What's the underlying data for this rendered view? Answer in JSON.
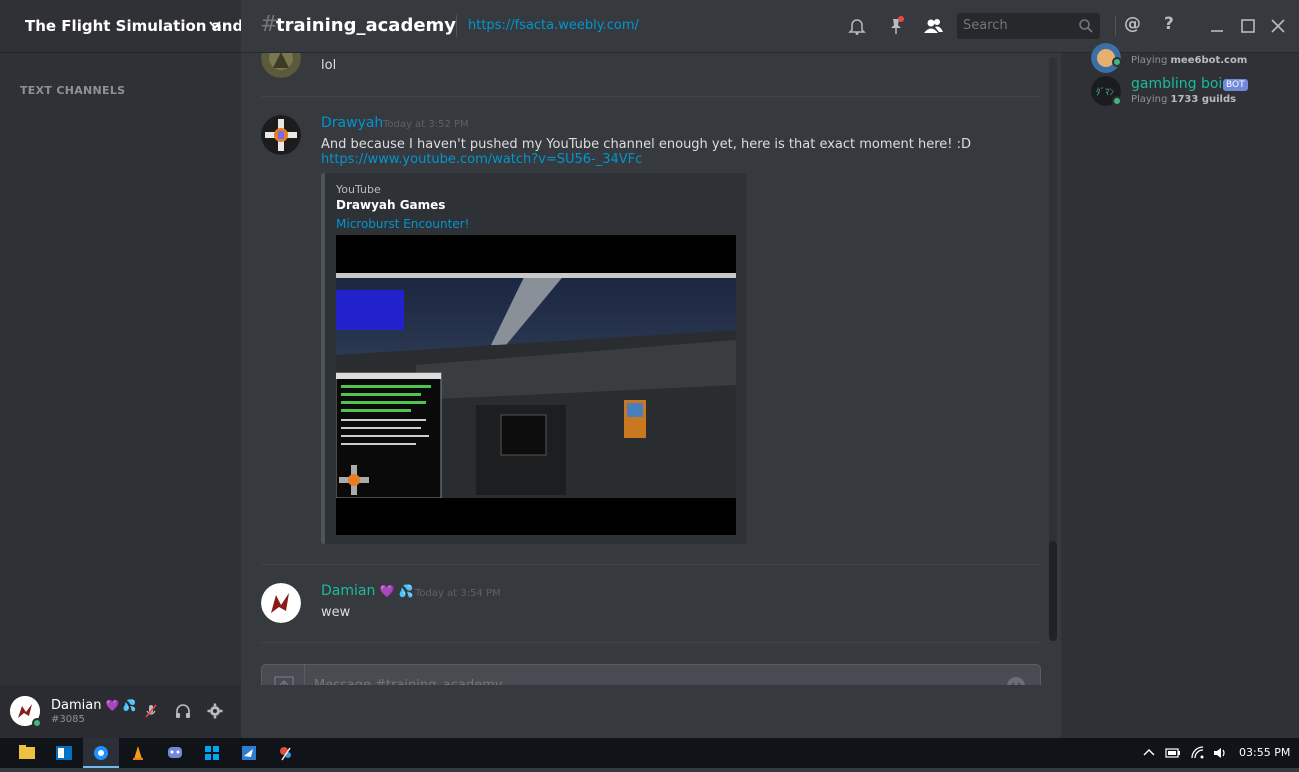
{
  "guild": {
    "name": "The Flight Simulation and...",
    "chevron_icon": "chevron-down-icon"
  },
  "sidebar": {
    "category_label": "TEXT CHANNELS"
  },
  "user_panel": {
    "name": "Damian",
    "badges": "💜 💦",
    "tag": "#3085"
  },
  "topbar": {
    "channel_hash": "#",
    "channel_name": "training_academy",
    "topic": "https://fsacta.weebly.com/",
    "search_placeholder": "Search",
    "icons": [
      "bell-icon",
      "pin-icon",
      "members-icon",
      "mention-icon",
      "help-icon",
      "minimize-icon",
      "maximize-icon",
      "close-icon"
    ],
    "help_glyph": "?",
    "mention_glyph": "@"
  },
  "messages": [
    {
      "author": "",
      "timestamp": "",
      "text": "lol"
    },
    {
      "author": "Drawyah",
      "author_color": "#0096cf",
      "timestamp": "Today at 3:52 PM",
      "text": "And because I haven't pushed my YouTube channel enough yet, here is that exact moment here! :D",
      "link": "https://www.youtube.com/watch?v=SU56-_34VFc",
      "embed": {
        "provider": "YouTube",
        "author": "Drawyah Games",
        "title": "Microburst Encounter!"
      }
    },
    {
      "author": "Damian",
      "author_badges": "💜 💦",
      "author_color": "#1abc9c",
      "timestamp": "Today at 3:54 PM",
      "text": "wew"
    }
  ],
  "composer": {
    "placeholder": "Message #training_academy"
  },
  "members": [
    {
      "name": "",
      "activity_prefix": "Playing ",
      "activity": "mee6bot.com"
    },
    {
      "name": "gambling boi",
      "bot_label": "BOT",
      "activity_prefix": "Playing ",
      "activity": "1733 guilds"
    }
  ],
  "taskbar": {
    "apps": [
      "file-explorer-icon",
      "outlook-icon",
      "browser-icon",
      "vlc-icon",
      "discord-icon",
      "store-icon",
      "flight-app-icon",
      "paint-icon"
    ],
    "tray_icons": [
      "chevron-up-icon",
      "keyboard-icon",
      "battery-icon",
      "wifi-icon",
      "volume-icon"
    ],
    "clock": "03:55 PM"
  }
}
